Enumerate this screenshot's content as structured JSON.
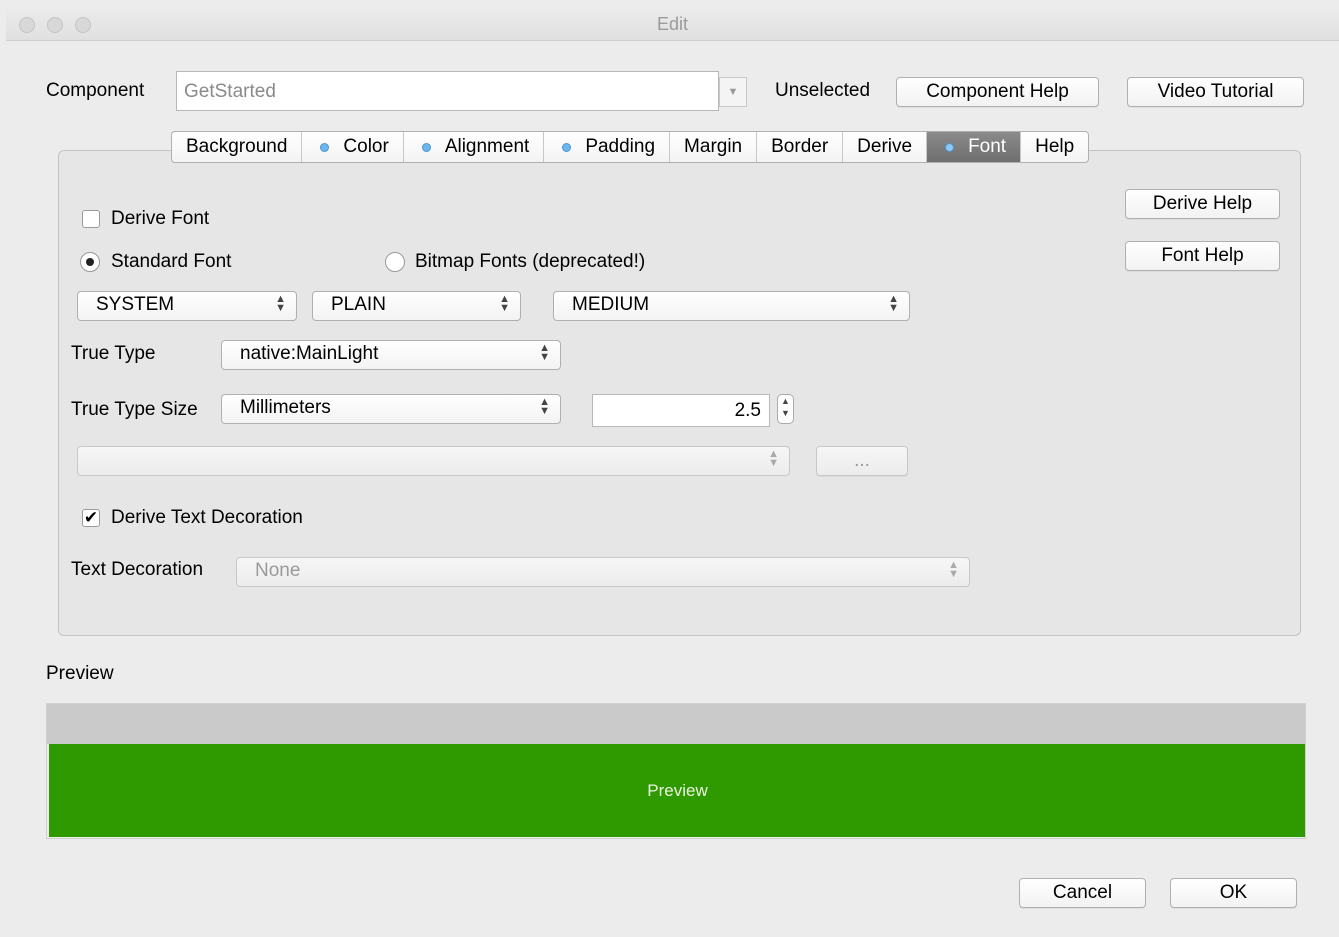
{
  "window": {
    "title": "Edit"
  },
  "header": {
    "component_label": "Component",
    "component_value": "GetStarted",
    "status": "Unselected",
    "component_help": "Component Help",
    "video_tutorial": "Video Tutorial"
  },
  "tabs": [
    {
      "label": "Background",
      "dot": false
    },
    {
      "label": "Color",
      "dot": true
    },
    {
      "label": "Alignment",
      "dot": true
    },
    {
      "label": "Padding",
      "dot": true
    },
    {
      "label": "Margin",
      "dot": false
    },
    {
      "label": "Border",
      "dot": false
    },
    {
      "label": "Derive",
      "dot": false
    },
    {
      "label": "Font",
      "dot": true,
      "active": true
    },
    {
      "label": "Help",
      "dot": false
    }
  ],
  "font_panel": {
    "derive_font": {
      "label": "Derive Font",
      "checked": false
    },
    "standard_font": {
      "label": "Standard Font",
      "selected": true
    },
    "bitmap_fonts": {
      "label": "Bitmap Fonts (deprecated!)",
      "selected": false
    },
    "face": "SYSTEM",
    "style": "PLAIN",
    "size": "MEDIUM",
    "true_type_label": "True Type",
    "true_type_value": "native:MainLight",
    "true_type_size_label": "True Type Size",
    "true_type_size_unit": "Millimeters",
    "true_type_size_value": "2.5",
    "bitmap_select_value": "",
    "ellipsis_button": "...",
    "derive_text_decoration": {
      "label": "Derive Text Decoration",
      "checked": true
    },
    "text_decoration_label": "Text Decoration",
    "text_decoration_value": "None",
    "derive_help": "Derive Help",
    "font_help": "Font Help"
  },
  "preview": {
    "label": "Preview",
    "text": "Preview",
    "color": "#2e9a00"
  },
  "footer": {
    "cancel": "Cancel",
    "ok": "OK"
  }
}
